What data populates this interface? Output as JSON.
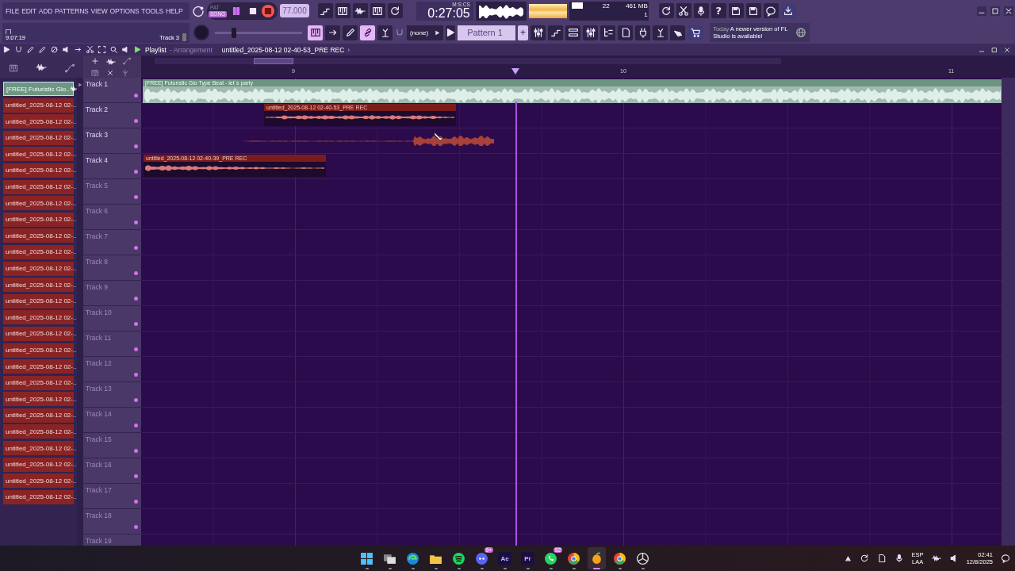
{
  "menu": [
    "FILE",
    "EDIT",
    "ADD",
    "PATTERNS",
    "VIEW",
    "OPTIONS",
    "TOOLS",
    "HELP"
  ],
  "transport": {
    "mode": [
      {
        "label": "PAT",
        "selected": false
      },
      {
        "label": "SONG",
        "selected": true
      }
    ],
    "tempo": "77.000",
    "time": "0:27:05",
    "time_format": "M:S:CS"
  },
  "cpu": {
    "voices": "22",
    "memory": "461 MB",
    "polyphony": "1"
  },
  "help_button": "?",
  "hint_panel": {
    "text": "9:07:19",
    "track": "Track 3"
  },
  "master_pitch": {
    "level": 0.2
  },
  "pattern_selector": {
    "preset": "(none)",
    "pattern": "Pattern 1",
    "add": "+"
  },
  "news": {
    "date": "Today",
    "message": "A newer version of FL Studio is available!"
  },
  "playlist": {
    "title": "Playlist",
    "view": "- Arrangement",
    "clip_name": "untitled_2025-08-12 02-40-53_PRE REC",
    "more": "›",
    "ruler": [
      "9",
      "10",
      "11"
    ],
    "clip_list": [
      {
        "label": "[FREE] Futuristic Glo..",
        "selected": true
      },
      {
        "label": "untitled_2025-08-12 02-..",
        "selected": false
      },
      {
        "label": "untitled_2025-08-12 02-..",
        "selected": false
      },
      {
        "label": "untitled_2025-08-12 02-..",
        "selected": false
      },
      {
        "label": "untitled_2025-08-12 02-..",
        "selected": false
      },
      {
        "label": "untitled_2025-08-12 02-..",
        "selected": false
      },
      {
        "label": "untitled_2025-08-12 02-..",
        "selected": false
      },
      {
        "label": "untitled_2025-08-12 02-..",
        "selected": false
      },
      {
        "label": "untitled_2025-08-12 02-..",
        "selected": false
      },
      {
        "label": "untitled_2025-08-12 02-..",
        "selected": false
      },
      {
        "label": "untitled_2025-08-12 02-..",
        "selected": false
      },
      {
        "label": "untitled_2025-08-12 02-..",
        "selected": false
      },
      {
        "label": "untitled_2025-08-12 02-..",
        "selected": false
      },
      {
        "label": "untitled_2025-08-12 02-..",
        "selected": false
      },
      {
        "label": "untitled_2025-08-12 02-..",
        "selected": false
      },
      {
        "label": "untitled_2025-08-12 02-..",
        "selected": false
      },
      {
        "label": "untitled_2025-08-12 02-..",
        "selected": false
      },
      {
        "label": "untitled_2025-08-12 02-..",
        "selected": false
      },
      {
        "label": "untitled_2025-08-12 02-..",
        "selected": false
      },
      {
        "label": "untitled_2025-08-12 02-..",
        "selected": false
      },
      {
        "label": "untitled_2025-08-12 02-..",
        "selected": false
      },
      {
        "label": "untitled_2025-08-12 02-..",
        "selected": false
      },
      {
        "label": "untitled_2025-08-12 02-..",
        "selected": false
      },
      {
        "label": "untitled_2025-08-12 02-..",
        "selected": false
      },
      {
        "label": "untitled_2025-08-12 02-..",
        "selected": false
      },
      {
        "label": "untitled_2025-08-12 02-..",
        "selected": false
      }
    ],
    "tracks": [
      {
        "name": "Track 1",
        "dimmed": false
      },
      {
        "name": "Track 2",
        "dimmed": false
      },
      {
        "name": "Track 3",
        "dimmed": false
      },
      {
        "name": "Track 4",
        "dimmed": false
      },
      {
        "name": "Track 5",
        "dimmed": true
      },
      {
        "name": "Track 6",
        "dimmed": true
      },
      {
        "name": "Track 7",
        "dimmed": true
      },
      {
        "name": "Track 8",
        "dimmed": true
      },
      {
        "name": "Track 9",
        "dimmed": true
      },
      {
        "name": "Track 10",
        "dimmed": true
      },
      {
        "name": "Track 11",
        "dimmed": true
      },
      {
        "name": "Track 12",
        "dimmed": true
      },
      {
        "name": "Track 13",
        "dimmed": true
      },
      {
        "name": "Track 14",
        "dimmed": true
      },
      {
        "name": "Track 15",
        "dimmed": true
      },
      {
        "name": "Track 16",
        "dimmed": true
      },
      {
        "name": "Track 17",
        "dimmed": true
      },
      {
        "name": "Track 18",
        "dimmed": true
      },
      {
        "name": "Track 19",
        "dimmed": true
      }
    ],
    "clips": [
      {
        "kind": "audio",
        "label": "[FREE] Futuristic Glo Type Beat - let´s party",
        "color": "#6d9480"
      },
      {
        "kind": "audio",
        "label": "untitled_2025-08-12 02-40-53_PRE REC",
        "color": "#7a1c1c"
      },
      {
        "kind": "recording",
        "color": "#a8413a"
      },
      {
        "kind": "audio",
        "label": "untitled_2025-08-12 02-40-39_PRE REC",
        "color": "#7a1c1c"
      }
    ]
  },
  "taskbar": {
    "apps": [
      {
        "kind": "start"
      },
      {
        "kind": "taskview"
      },
      {
        "kind": "browser"
      },
      {
        "kind": "folder"
      },
      {
        "kind": "music"
      },
      {
        "kind": "chat",
        "badge": "9+"
      },
      {
        "kind": "tile",
        "label": "Ae"
      },
      {
        "kind": "tile",
        "label": "Pr"
      },
      {
        "kind": "phone",
        "badge": "92"
      },
      {
        "kind": "ring"
      },
      {
        "kind": "fruit",
        "active": true
      },
      {
        "kind": "ring"
      },
      {
        "kind": "aperture"
      }
    ],
    "language": "ESP",
    "layout": "LAA",
    "clock": "02:41",
    "date": "12/8/2025"
  }
}
